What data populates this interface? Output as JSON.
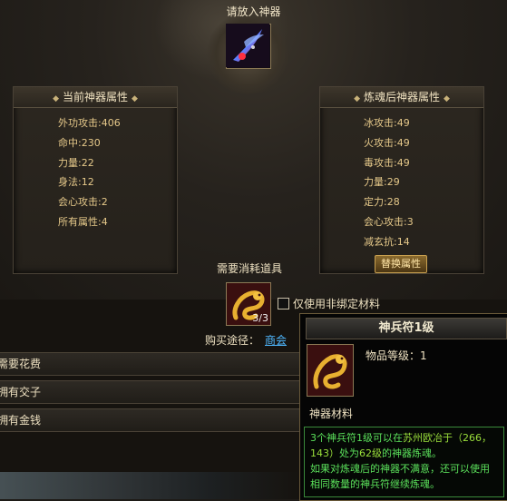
{
  "top": {
    "put_label": "请放入神器"
  },
  "current_panel": {
    "title": "当前神器属性",
    "stats": [
      "外功攻击:406",
      "命中:230",
      "力量:22",
      "身法:12",
      "会心攻击:2",
      "所有属性:4"
    ]
  },
  "refined_panel": {
    "title": "炼魂后神器属性",
    "stats": [
      "冰攻击:49",
      "火攻击:49",
      "毒攻击:49",
      "力量:29",
      "定力:28",
      "会心攻击:3",
      "减玄抗:14"
    ],
    "replace_button": "替换属性"
  },
  "consume": {
    "title": "需要消耗道具",
    "item_count": "3/3",
    "checkbox_label": "仅使用非绑定材料",
    "buy_label": "购买途径：",
    "buy_link": "商会"
  },
  "rows": [
    "需要花费",
    "拥有交子",
    "拥有金钱"
  ],
  "tooltip": {
    "title": "神兵符1级",
    "level": "物品等级：1",
    "type": "神器材料",
    "desc_prefix": "3个神兵符1级可以在",
    "desc_location": "苏州欧冶于（266，143）",
    "desc_mid": "处为",
    "desc_level": "62级",
    "desc_suffix": "的神器炼魂。",
    "desc_line2": "如果对炼魂后的神器不满意，还可以使用相同数量的神兵符继续炼魂。"
  },
  "colors": {
    "accent_gold": "#e6c98a",
    "link": "#4fb8ff",
    "desc_green": "#5be05b",
    "location_pink": "#e06ad9"
  }
}
